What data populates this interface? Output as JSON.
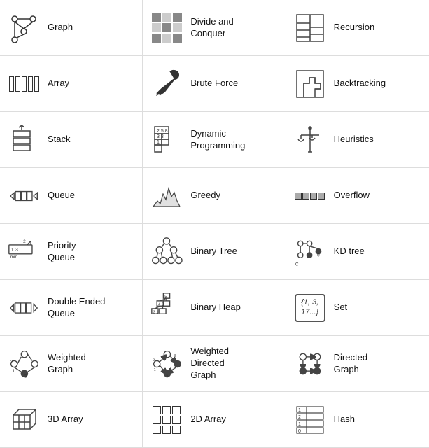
{
  "items": [
    {
      "id": "graph",
      "label": "Graph"
    },
    {
      "id": "divide-conquer",
      "label": "Divide and\nConquer"
    },
    {
      "id": "recursion",
      "label": "Recursion"
    },
    {
      "id": "array",
      "label": "Array"
    },
    {
      "id": "brute-force",
      "label": "Brute Force"
    },
    {
      "id": "backtracking",
      "label": "Backtracking"
    },
    {
      "id": "stack",
      "label": "Stack"
    },
    {
      "id": "dynamic-programming",
      "label": "Dynamic\nProgramming"
    },
    {
      "id": "heuristics",
      "label": "Heuristics"
    },
    {
      "id": "queue",
      "label": "Queue"
    },
    {
      "id": "greedy",
      "label": "Greedy"
    },
    {
      "id": "overflow",
      "label": "Overflow"
    },
    {
      "id": "priority-queue",
      "label": "Priority\nQueue"
    },
    {
      "id": "binary-tree",
      "label": "Binary Tree"
    },
    {
      "id": "kd-tree",
      "label": "KD tree"
    },
    {
      "id": "double-ended-queue",
      "label": "Double Ended\nQueue"
    },
    {
      "id": "binary-heap",
      "label": "Binary Heap"
    },
    {
      "id": "set",
      "label": "Set"
    },
    {
      "id": "weighted-graph",
      "label": "Weighted\nGraph"
    },
    {
      "id": "weighted-directed-graph",
      "label": "Weighted\nDirected\nGraph"
    },
    {
      "id": "directed-graph",
      "label": "Directed\nGraph"
    },
    {
      "id": "3d-array",
      "label": "3D Array"
    },
    {
      "id": "2d-array",
      "label": "2D Array"
    },
    {
      "id": "hash",
      "label": "Hash"
    }
  ]
}
